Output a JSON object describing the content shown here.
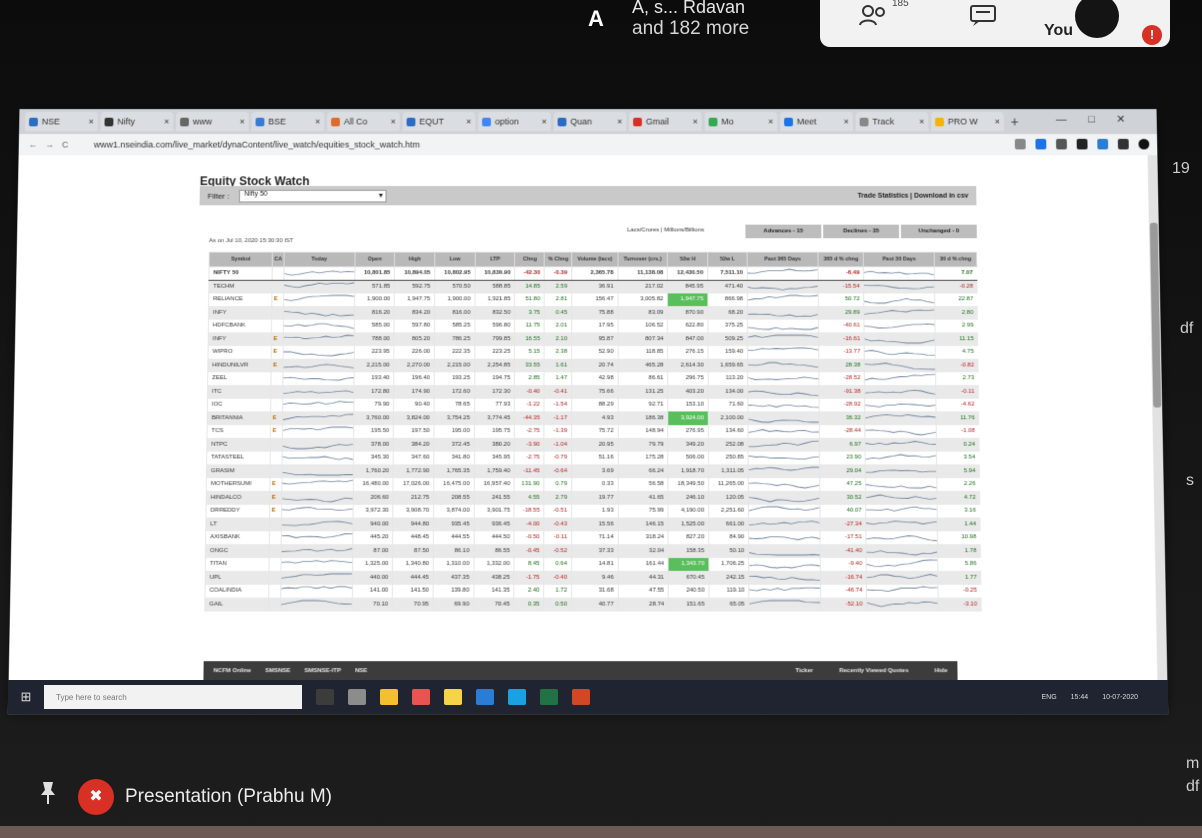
{
  "meet": {
    "avatar_letter": "A",
    "names_line": "A, s... Rdavan",
    "more_text": "and 182 more",
    "people_count": "185",
    "you_label": "You",
    "presenter_label": "Presentation (Prabhu M)"
  },
  "browser": {
    "tabs": [
      {
        "label": "NSE",
        "color": "#2b6cc4"
      },
      {
        "label": "Nifty",
        "color": "#333333"
      },
      {
        "label": "www",
        "color": "#666666"
      },
      {
        "label": "BSE",
        "color": "#3a7bd5"
      },
      {
        "label": "All Co",
        "color": "#e06a2a"
      },
      {
        "label": "EQUT",
        "color": "#2b6cc4"
      },
      {
        "label": "option",
        "color": "#4285f4"
      },
      {
        "label": "Quan",
        "color": "#2b6cc4"
      },
      {
        "label": "Gmail",
        "color": "#d93025"
      },
      {
        "label": "Mo",
        "color": "#34a853"
      },
      {
        "label": "Meet",
        "color": "#1a73e8"
      },
      {
        "label": "Track",
        "color": "#888888"
      },
      {
        "label": "PRO W",
        "color": "#f4b400"
      }
    ],
    "url": "www1.nseindia.com/live_market/dynaContent/live_watch/equities_stock_watch.htm"
  },
  "page": {
    "title": "Equity Stock Watch",
    "filter_label": "Filter :",
    "filter_value": "Nifty 50",
    "trade_links": "Trade Statistics | Download in csv",
    "as_of": "As on Jul 10, 2020 15:30:30 IST",
    "view_links": "Lacs/Crores | Millions/Billions",
    "advances": "Advances - 15",
    "declines": "Declines - 35",
    "unchanged": "Unchanged - 0",
    "columns": [
      "Symbol",
      "CA",
      "Today",
      "Open",
      "High",
      "Low",
      "LTP",
      "Chng",
      "% Chng",
      "Volume (lacs)",
      "Turnover (crs.)",
      "52w H",
      "52w L",
      "Past 365 Days",
      "365 d % chng",
      "Past 30 Days",
      "30 d % chng"
    ],
    "rows": [
      {
        "symbol": "NIFTY 50",
        "ca": "",
        "open": "10,801.85",
        "high": "10,894.05",
        "low": "10,802.95",
        "ltp": "10,830.90",
        "chng": "-42.30",
        "pchng": "-0.39",
        "vol": "2,365.78",
        "turn": "11,138.08",
        "h52": "12,430.50",
        "l52": "7,511.10",
        "d365": "-6.49",
        "d30": "7.07"
      },
      {
        "symbol": "TECHM",
        "ca": "",
        "open": "571.85",
        "high": "592.75",
        "low": "570.50",
        "ltp": "588.85",
        "chng": "14.85",
        "pchng": "2.59",
        "vol": "36.91",
        "turn": "217.02",
        "h52": "845.95",
        "l52": "471.40",
        "d365": "-15.54",
        "d30": "-0.28"
      },
      {
        "symbol": "RELIANCE",
        "ca": "E",
        "open": "1,900.00",
        "high": "1,947.75",
        "low": "1,900.00",
        "ltp": "1,921.85",
        "chng": "51.80",
        "pchng": "2.81",
        "vol": "156.47",
        "turn": "3,005.82",
        "h52": "1,947.75",
        "l52": "866.98",
        "d365": "50.72",
        "d30": "22.87",
        "hi": true
      },
      {
        "symbol": "INFY",
        "ca": "",
        "open": "816.20",
        "high": "834.20",
        "low": "816.00",
        "ltp": "832.50",
        "chng": "3.75",
        "pchng": "0.45",
        "vol": "75.88",
        "turn": "83.09",
        "h52": "870.90",
        "l52": "68.20",
        "d365": "29.89",
        "d30": "2.80"
      },
      {
        "symbol": "HDFCBANK",
        "ca": "",
        "open": "585.00",
        "high": "597.80",
        "low": "585.25",
        "ltp": "596.80",
        "chng": "11.75",
        "pchng": "2.01",
        "vol": "17.95",
        "turn": "106.52",
        "h52": "622.80",
        "l52": "375.25",
        "d365": "-40.61",
        "d30": "2.99"
      },
      {
        "symbol": "INFY",
        "ca": "E",
        "open": "788.00",
        "high": "805.20",
        "low": "786.25",
        "ltp": "799.85",
        "chng": "16.55",
        "pchng": "2.10",
        "vol": "95.87",
        "turn": "807.34",
        "h52": "847.00",
        "l52": "509.25",
        "d365": "-16.61",
        "d30": "11.15"
      },
      {
        "symbol": "WIPRO",
        "ca": "E",
        "open": "223.95",
        "high": "226.00",
        "low": "222.35",
        "ltp": "223.25",
        "chng": "5.15",
        "pchng": "2.38",
        "vol": "52.90",
        "turn": "118.85",
        "h52": "276.15",
        "l52": "159.40",
        "d365": "-13.77",
        "d30": "4.75"
      },
      {
        "symbol": "HINDUNILVR",
        "ca": "E",
        "open": "2,215.00",
        "high": "2,270.00",
        "low": "2,215.00",
        "ltp": "2,254.85",
        "chng": "33.55",
        "pchng": "1.61",
        "vol": "20.74",
        "turn": "465.28",
        "h52": "2,614.30",
        "l52": "1,659.65",
        "d365": "28.38",
        "d30": "-0.82"
      },
      {
        "symbol": "ZEEL",
        "ca": "",
        "open": "193.40",
        "high": "196.40",
        "low": "193.25",
        "ltp": "194.75",
        "chng": "2.85",
        "pchng": "1.47",
        "vol": "42.98",
        "turn": "86.61",
        "h52": "296.75",
        "l52": "113.20",
        "d365": "-28.52",
        "d30": "2.73"
      },
      {
        "symbol": "ITC",
        "ca": "",
        "open": "172.80",
        "high": "174.90",
        "low": "172.60",
        "ltp": "172.30",
        "chng": "-0.40",
        "pchng": "-0.41",
        "vol": "75.66",
        "turn": "131.25",
        "h52": "403.20",
        "l52": "134.00",
        "d365": "-91.38",
        "d30": "-0.11"
      },
      {
        "symbol": "IOC",
        "ca": "",
        "open": "79.90",
        "high": "90.40",
        "low": "78.65",
        "ltp": "77.93",
        "chng": "-1.22",
        "pchng": "-1.54",
        "vol": "88.29",
        "turn": "92.71",
        "h52": "153.10",
        "l52": "71.60",
        "d365": "-28.92",
        "d30": "-4.62"
      },
      {
        "symbol": "BRITANNIA",
        "ca": "E",
        "open": "3,760.00",
        "high": "3,824.00",
        "low": "3,754.25",
        "ltp": "3,774.45",
        "chng": "-44.35",
        "pchng": "-1.17",
        "vol": "4.93",
        "turn": "186.38",
        "h52": "3,924.00",
        "l52": "2,100.00",
        "d365": "36.32",
        "d30": "11.76",
        "hi": true
      },
      {
        "symbol": "TCS",
        "ca": "E",
        "open": "195.50",
        "high": "197.50",
        "low": "195.00",
        "ltp": "195.75",
        "chng": "-2.75",
        "pchng": "-1.39",
        "vol": "75.72",
        "turn": "148.94",
        "h52": "276.95",
        "l52": "134.60",
        "d365": "-28.44",
        "d30": "-1.08"
      },
      {
        "symbol": "NTPC",
        "ca": "",
        "open": "378.00",
        "high": "384.20",
        "low": "372.45",
        "ltp": "380.20",
        "chng": "-3.90",
        "pchng": "-1.04",
        "vol": "20.95",
        "turn": "79.79",
        "h52": "349.20",
        "l52": "252.08",
        "d365": "6.97",
        "d30": "0.24"
      },
      {
        "symbol": "TATASTEEL",
        "ca": "",
        "open": "345.30",
        "high": "347.60",
        "low": "341.80",
        "ltp": "345.95",
        "chng": "-2.75",
        "pchng": "-0.79",
        "vol": "51.16",
        "turn": "175.28",
        "h52": "506.00",
        "l52": "250.85",
        "d365": "23.90",
        "d30": "3.54"
      },
      {
        "symbol": "GRASIM",
        "ca": "",
        "open": "1,760.20",
        "high": "1,772.90",
        "low": "1,765.35",
        "ltp": "1,759.40",
        "chng": "-11.45",
        "pchng": "-0.64",
        "vol": "3.69",
        "turn": "66.24",
        "h52": "1,918.70",
        "l52": "1,311.05",
        "d365": "29.04",
        "d30": "5.94"
      },
      {
        "symbol": "MOTHERSUMI",
        "ca": "E",
        "open": "16,480.00",
        "high": "17,026.00",
        "low": "16,475.00",
        "ltp": "16,957.40",
        "chng": "131.90",
        "pchng": "0.79",
        "vol": "0.33",
        "turn": "56.58",
        "h52": "18,349.50",
        "l52": "11,265.00",
        "d365": "47.25",
        "d30": "2.26"
      },
      {
        "symbol": "HINDALCO",
        "ca": "E",
        "open": "206.60",
        "high": "212.75",
        "low": "208.55",
        "ltp": "241.55",
        "chng": "4.55",
        "pchng": "2.79",
        "vol": "19.77",
        "turn": "41.65",
        "h52": "246.10",
        "l52": "120.05",
        "d365": "30.52",
        "d30": "4.72"
      },
      {
        "symbol": "DRREDDY",
        "ca": "E",
        "open": "3,972.30",
        "high": "3,908.70",
        "low": "3,874.00",
        "ltp": "3,901.75",
        "chng": "-18.55",
        "pchng": "-0.51",
        "vol": "1.93",
        "turn": "75.99",
        "h52": "4,190.00",
        "l52": "2,251.60",
        "d365": "40.07",
        "d30": "3.16"
      },
      {
        "symbol": "LT",
        "ca": "",
        "open": "940.00",
        "high": "944.80",
        "low": "935.45",
        "ltp": "936.45",
        "chng": "-4.00",
        "pchng": "-0.43",
        "vol": "15.56",
        "turn": "146.15",
        "h52": "1,525.00",
        "l52": "661.00",
        "d365": "-27.34",
        "d30": "1.44"
      },
      {
        "symbol": "AXISBANK",
        "ca": "",
        "open": "445.20",
        "high": "448.45",
        "low": "444.55",
        "ltp": "444.50",
        "chng": "-0.50",
        "pchng": "-0.11",
        "vol": "71.14",
        "turn": "318.24",
        "h52": "827.20",
        "l52": "84.90",
        "d365": "-17.51",
        "d30": "10.98"
      },
      {
        "symbol": "ONGC",
        "ca": "",
        "open": "87.00",
        "high": "87.50",
        "low": "86.10",
        "ltp": "86.55",
        "chng": "-0.45",
        "pchng": "-0.52",
        "vol": "37.33",
        "turn": "32.04",
        "h52": "158.35",
        "l52": "50.10",
        "d365": "-41.40",
        "d30": "1.78"
      },
      {
        "symbol": "TITAN",
        "ca": "",
        "open": "1,325.00",
        "high": "1,340.80",
        "low": "1,310.00",
        "ltp": "1,332.00",
        "chng": "8.45",
        "pchng": "0.64",
        "vol": "14.81",
        "turn": "161.44",
        "h52": "1,343.70",
        "l52": "1,706.25",
        "d365": "-9.40",
        "d30": "5.86",
        "hi": true
      },
      {
        "symbol": "UPL",
        "ca": "",
        "open": "440.00",
        "high": "444.45",
        "low": "437.35",
        "ltp": "438.25",
        "chng": "-1.75",
        "pchng": "-0.40",
        "vol": "9.46",
        "turn": "44.31",
        "h52": "670.45",
        "l52": "242.15",
        "d365": "-16.74",
        "d30": "1.77"
      },
      {
        "symbol": "COALINDIA",
        "ca": "",
        "open": "141.00",
        "high": "141.50",
        "low": "139.80",
        "ltp": "141.35",
        "chng": "2.40",
        "pchng": "1.72",
        "vol": "31.68",
        "turn": "47.55",
        "h52": "240.50",
        "l52": "119.10",
        "d365": "-46.74",
        "d30": "-0.25"
      },
      {
        "symbol": "GAIL",
        "ca": "",
        "open": "70.10",
        "high": "70.95",
        "low": "69.90",
        "ltp": "70.45",
        "chng": "0.35",
        "pchng": "0.50",
        "vol": "40.77",
        "turn": "28.74",
        "h52": "151.65",
        "l52": "65.05",
        "d365": "-52.10",
        "d30": "-3.10"
      }
    ],
    "footer_left": [
      "NCFM Online",
      "SMSNSE",
      "SMSNSE-ITP",
      "NSE"
    ],
    "footer_right": [
      "Ticker",
      "Recently Viewed Quotes",
      "Hide"
    ]
  },
  "taskbar": {
    "search_placeholder": "Type here to search",
    "apps": [
      "#3c3c3c",
      "#8c8c8c",
      "#f3c12d",
      "#e8554e",
      "#f5d44a",
      "#2b7cd3",
      "#1ba1e2",
      "#217346",
      "#d24726"
    ],
    "tray": [
      "ENG",
      "15:44",
      "10-07-2020"
    ]
  },
  "colors": {
    "accent_green": "#58bf5c",
    "meet_red": "#d93025",
    "header_gray": "#b9b9b9"
  }
}
